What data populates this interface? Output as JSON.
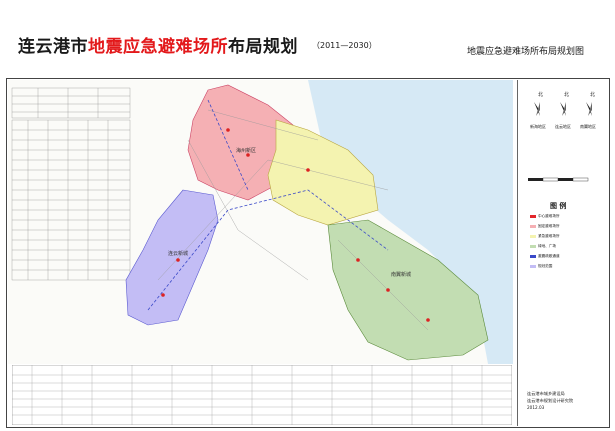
{
  "title": {
    "part1": "连云港市",
    "part2": "地震应急避难场所",
    "part3": "布局规划",
    "years": "（2011—2030）",
    "right": "地震应急避难场所布局规划图"
  },
  "map": {
    "districts": [
      "海州新区",
      "连云新城",
      "南翼新城"
    ],
    "colors": {
      "red": "#f5b0b4",
      "yellow": "#f4f3b0",
      "blue": "#c3bdf5",
      "green": "#c2ddb2",
      "sea": "#d6e9f5"
    }
  },
  "compass": [
    "北",
    "北",
    "北"
  ],
  "compass_labels": [
    "新海地区",
    "连云地区",
    "南翼地区"
  ],
  "legend": {
    "title": "图 例",
    "items": [
      "中心避难场所",
      "固定避难场所",
      "紧急避难场所",
      "绿地、广场",
      "避震疏散通道",
      "规划范围"
    ]
  },
  "credits": [
    "连云港市城乡建设局",
    "连云港市规划设计研究院",
    "2012.03"
  ]
}
